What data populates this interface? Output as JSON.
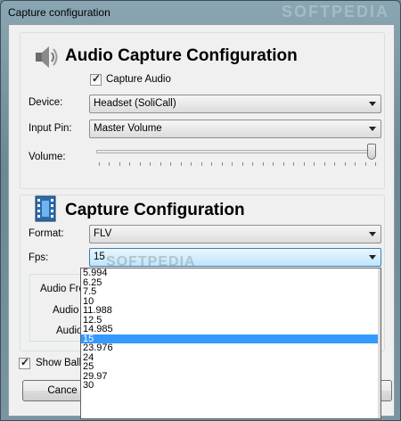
{
  "window": {
    "title": "Capture configuration",
    "title_watermark": "SOFTPEDIA"
  },
  "audio": {
    "heading": "Audio Capture Configuration",
    "capture_audio_label": "Capture Audio",
    "capture_audio_checked": true,
    "device_label": "Device:",
    "device_value": "Headset (SoliCall)",
    "input_pin_label": "Input Pin:",
    "input_pin_value": "Master Volume",
    "volume_label": "Volume:",
    "volume_level": 1.0
  },
  "capture": {
    "heading": "Capture Configuration",
    "format_label": "Format:",
    "format_value": "FLV",
    "fps_label": "Fps:",
    "fps_value": "15",
    "audio_freq_label": "Audio Fre",
    "audio_c_label": "Audio C",
    "audio_label": "Audio"
  },
  "show_balloon_label": "Show Ballo",
  "show_balloon_checked": true,
  "cancel_label": "Cance",
  "fps_options": [
    "5.994",
    "6.25",
    "7.5",
    "10",
    "11.988",
    "12.5",
    "14.985",
    "15",
    "23.976",
    "24",
    "25",
    "29.97",
    "30"
  ],
  "fps_selected_index": 7,
  "watermark": "SOFTPEDIA"
}
